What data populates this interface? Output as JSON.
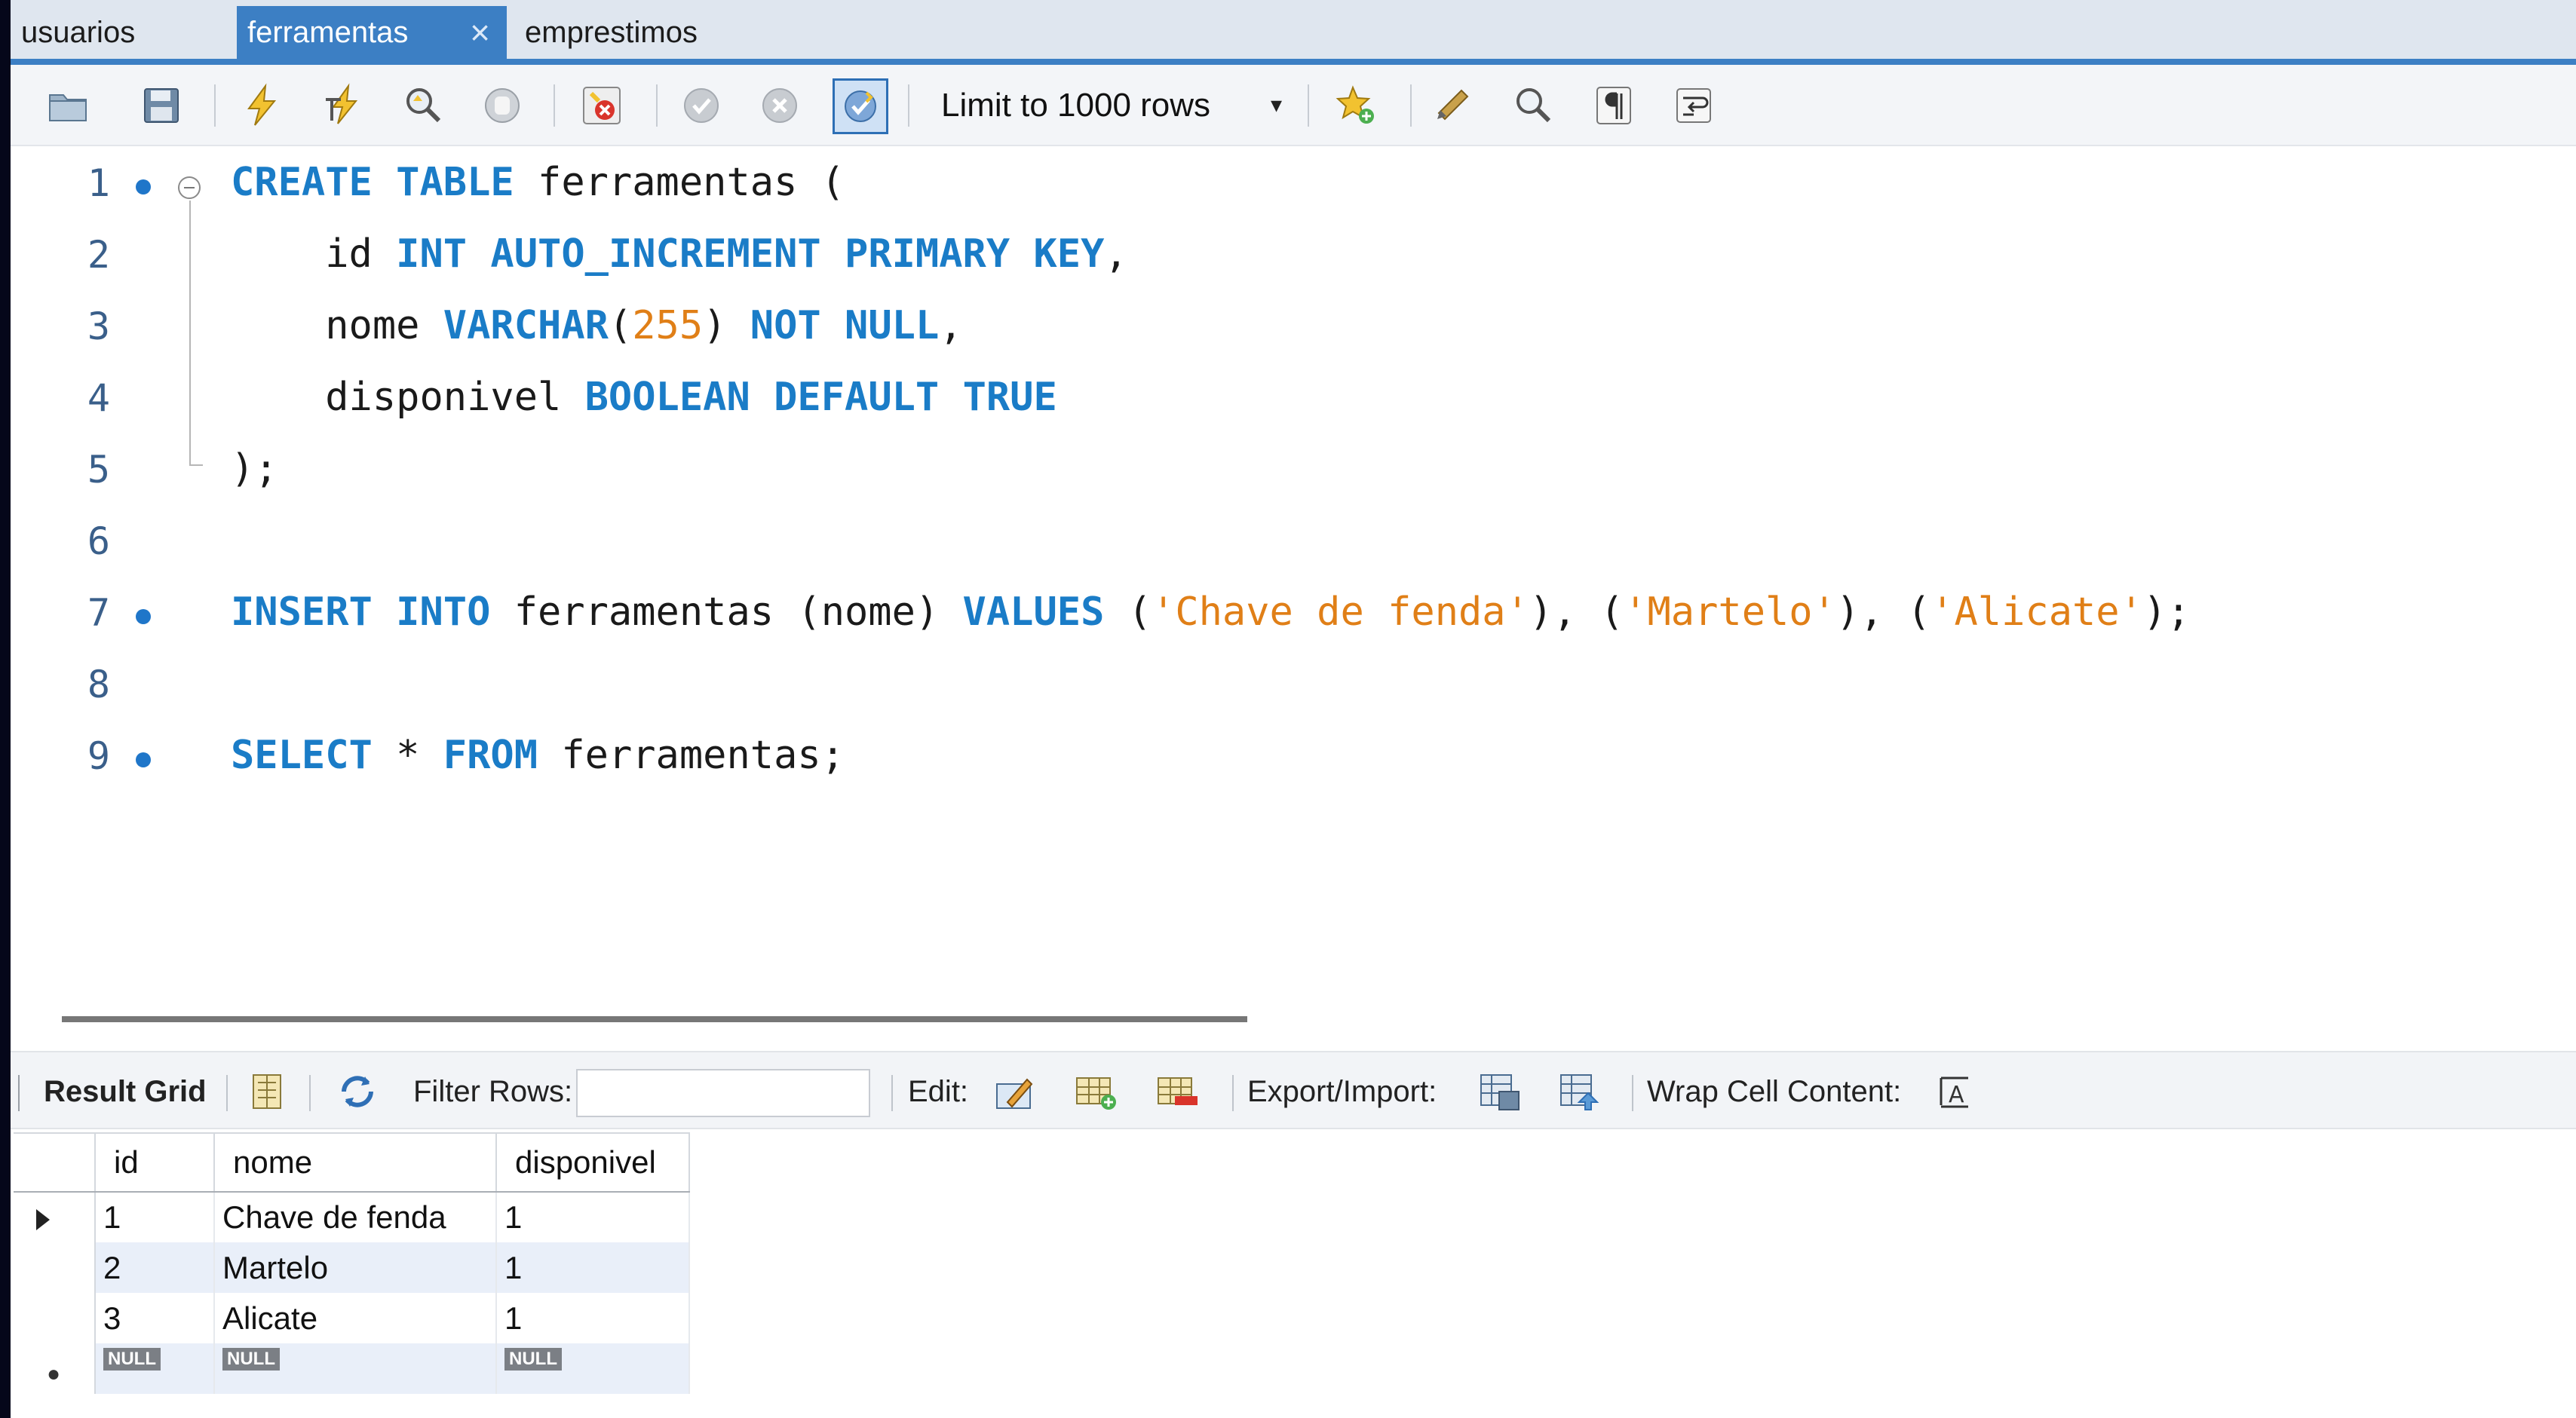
{
  "tabs": [
    {
      "label": "usuarios"
    },
    {
      "label": "ferramentas",
      "active": true,
      "close": "×"
    },
    {
      "label": "emprestimos"
    }
  ],
  "toolbar": {
    "icons": [
      "open-folder-icon",
      "save-icon",
      "execute-icon",
      "execute-current-icon",
      "explain-icon",
      "stop-icon",
      "stop-on-error-icon",
      "commit-icon",
      "rollback-icon",
      "autocommit-icon",
      "add-snippet-icon",
      "beautify-icon",
      "find-icon",
      "invisible-chars-icon",
      "wrap-icon"
    ],
    "limit": {
      "label": "Limit to 1000 rows",
      "arrow": "▾"
    }
  },
  "editor": {
    "line_numbers": [
      "1",
      "2",
      "3",
      "4",
      "5",
      "6",
      "7",
      "8",
      "9"
    ],
    "tokens": {
      "l1": [
        "CREATE",
        "TABLE",
        "ferramentas",
        "("
      ],
      "l2": [
        "id",
        "INT",
        "AUTO_INCREMENT",
        "PRIMARY",
        "KEY",
        ","
      ],
      "l3": [
        "nome",
        "VARCHAR",
        "(",
        "255",
        ")",
        "NOT",
        "NULL",
        ","
      ],
      "l4": [
        "disponivel",
        "BOOLEAN",
        "DEFAULT",
        "TRUE"
      ],
      "l5": [
        ");"
      ],
      "l7": [
        "INSERT",
        "INTO",
        "ferramentas",
        "(nome)",
        "VALUES",
        "(",
        "'Chave de fenda'",
        "), (",
        "'Martelo'",
        "), (",
        "'Alicate'",
        ");"
      ],
      "l9": [
        "SELECT",
        "*",
        "FROM",
        "ferramentas;"
      ]
    }
  },
  "result_toolbar": {
    "result_grid": "Result Grid",
    "filter_label": "Filter Rows:",
    "filter_value": "",
    "edit_label": "Edit:",
    "export_label": "Export/Import:",
    "wrap_label": "Wrap Cell Content:"
  },
  "grid": {
    "columns": [
      "id",
      "nome",
      "disponivel"
    ],
    "rows": [
      [
        "1",
        "Chave de fenda",
        "1"
      ],
      [
        "2",
        "Martelo",
        "1"
      ],
      [
        "3",
        "Alicate",
        "1"
      ]
    ],
    "new_row": [
      "NULL",
      "NULL",
      "NULL"
    ],
    "new_row_marker": "●"
  },
  "colors": {
    "keyword": "#1a7cc7",
    "literal": "#e07f17",
    "tab_active": "#3c7fc4",
    "grid_alt_row": "#e9eff9"
  }
}
